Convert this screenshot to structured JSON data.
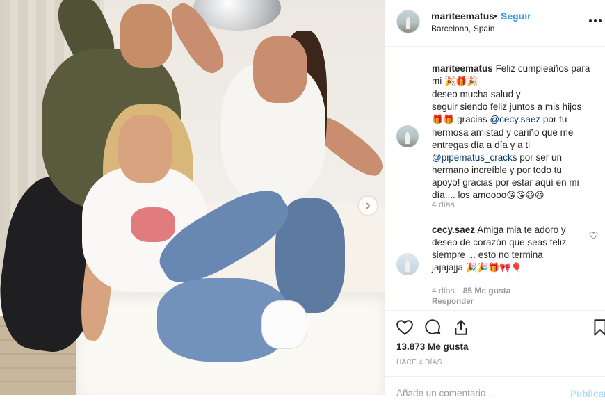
{
  "header": {
    "username": "mariteematus",
    "separator": "•",
    "follow_label": "Seguir",
    "location": "Barcelona, Spain",
    "more_icon": "more-horizontal-icon"
  },
  "caption": {
    "username": "mariteematus",
    "line1": "Feliz cumpleaños para",
    "line2_pre": "mi ",
    "line2_emoji": "🎉🎁🎉",
    "line3": "deseo mucha salud y",
    "line4": "seguir siendo feliz juntos a mis hijos",
    "line5_emoji": "🎁🎁",
    "line5_text": " gracias ",
    "mention1": "@cecy.saez",
    "line5_post": " por tu",
    "line6": "hermosa amistad y cariño que me",
    "line7": "entregas día a día y a ti",
    "mention2": "@pipematus_cracks",
    "line8_post": " por ser un",
    "line9": "hermano increíble y por todo tu",
    "line10": "apoyo! gracias por estar aquí en mi",
    "line11": "día.... los amoooo",
    "line11_emoji": "😘😘😃😃",
    "time": "4 días"
  },
  "comment": {
    "username": "cecy.saez",
    "line1": " Amiga mia te adoro y",
    "line2": "deseo de corazón que seas feliz",
    "line3": "siempre ... esto no termina",
    "line4": "jajajajja ",
    "line4_emoji": "🎉🎉🎁🎀🎈",
    "time": "4 días",
    "likes": "85 Me gusta",
    "reply_label": "Responder"
  },
  "actions": {
    "like_icon": "heart-icon",
    "comment_icon": "comment-icon",
    "share_icon": "share-icon",
    "save_icon": "bookmark-icon"
  },
  "likes_text": "13.873 Me gusta",
  "posted_ago": "HACE 4 DÍAS",
  "add_comment": {
    "placeholder": "Añade un comentario...",
    "publish_label": "Publicar"
  },
  "colors": {
    "link_blue": "#3897f0",
    "mention": "#003569",
    "muted": "#999999",
    "publish_disabled": "#b3dbff"
  }
}
